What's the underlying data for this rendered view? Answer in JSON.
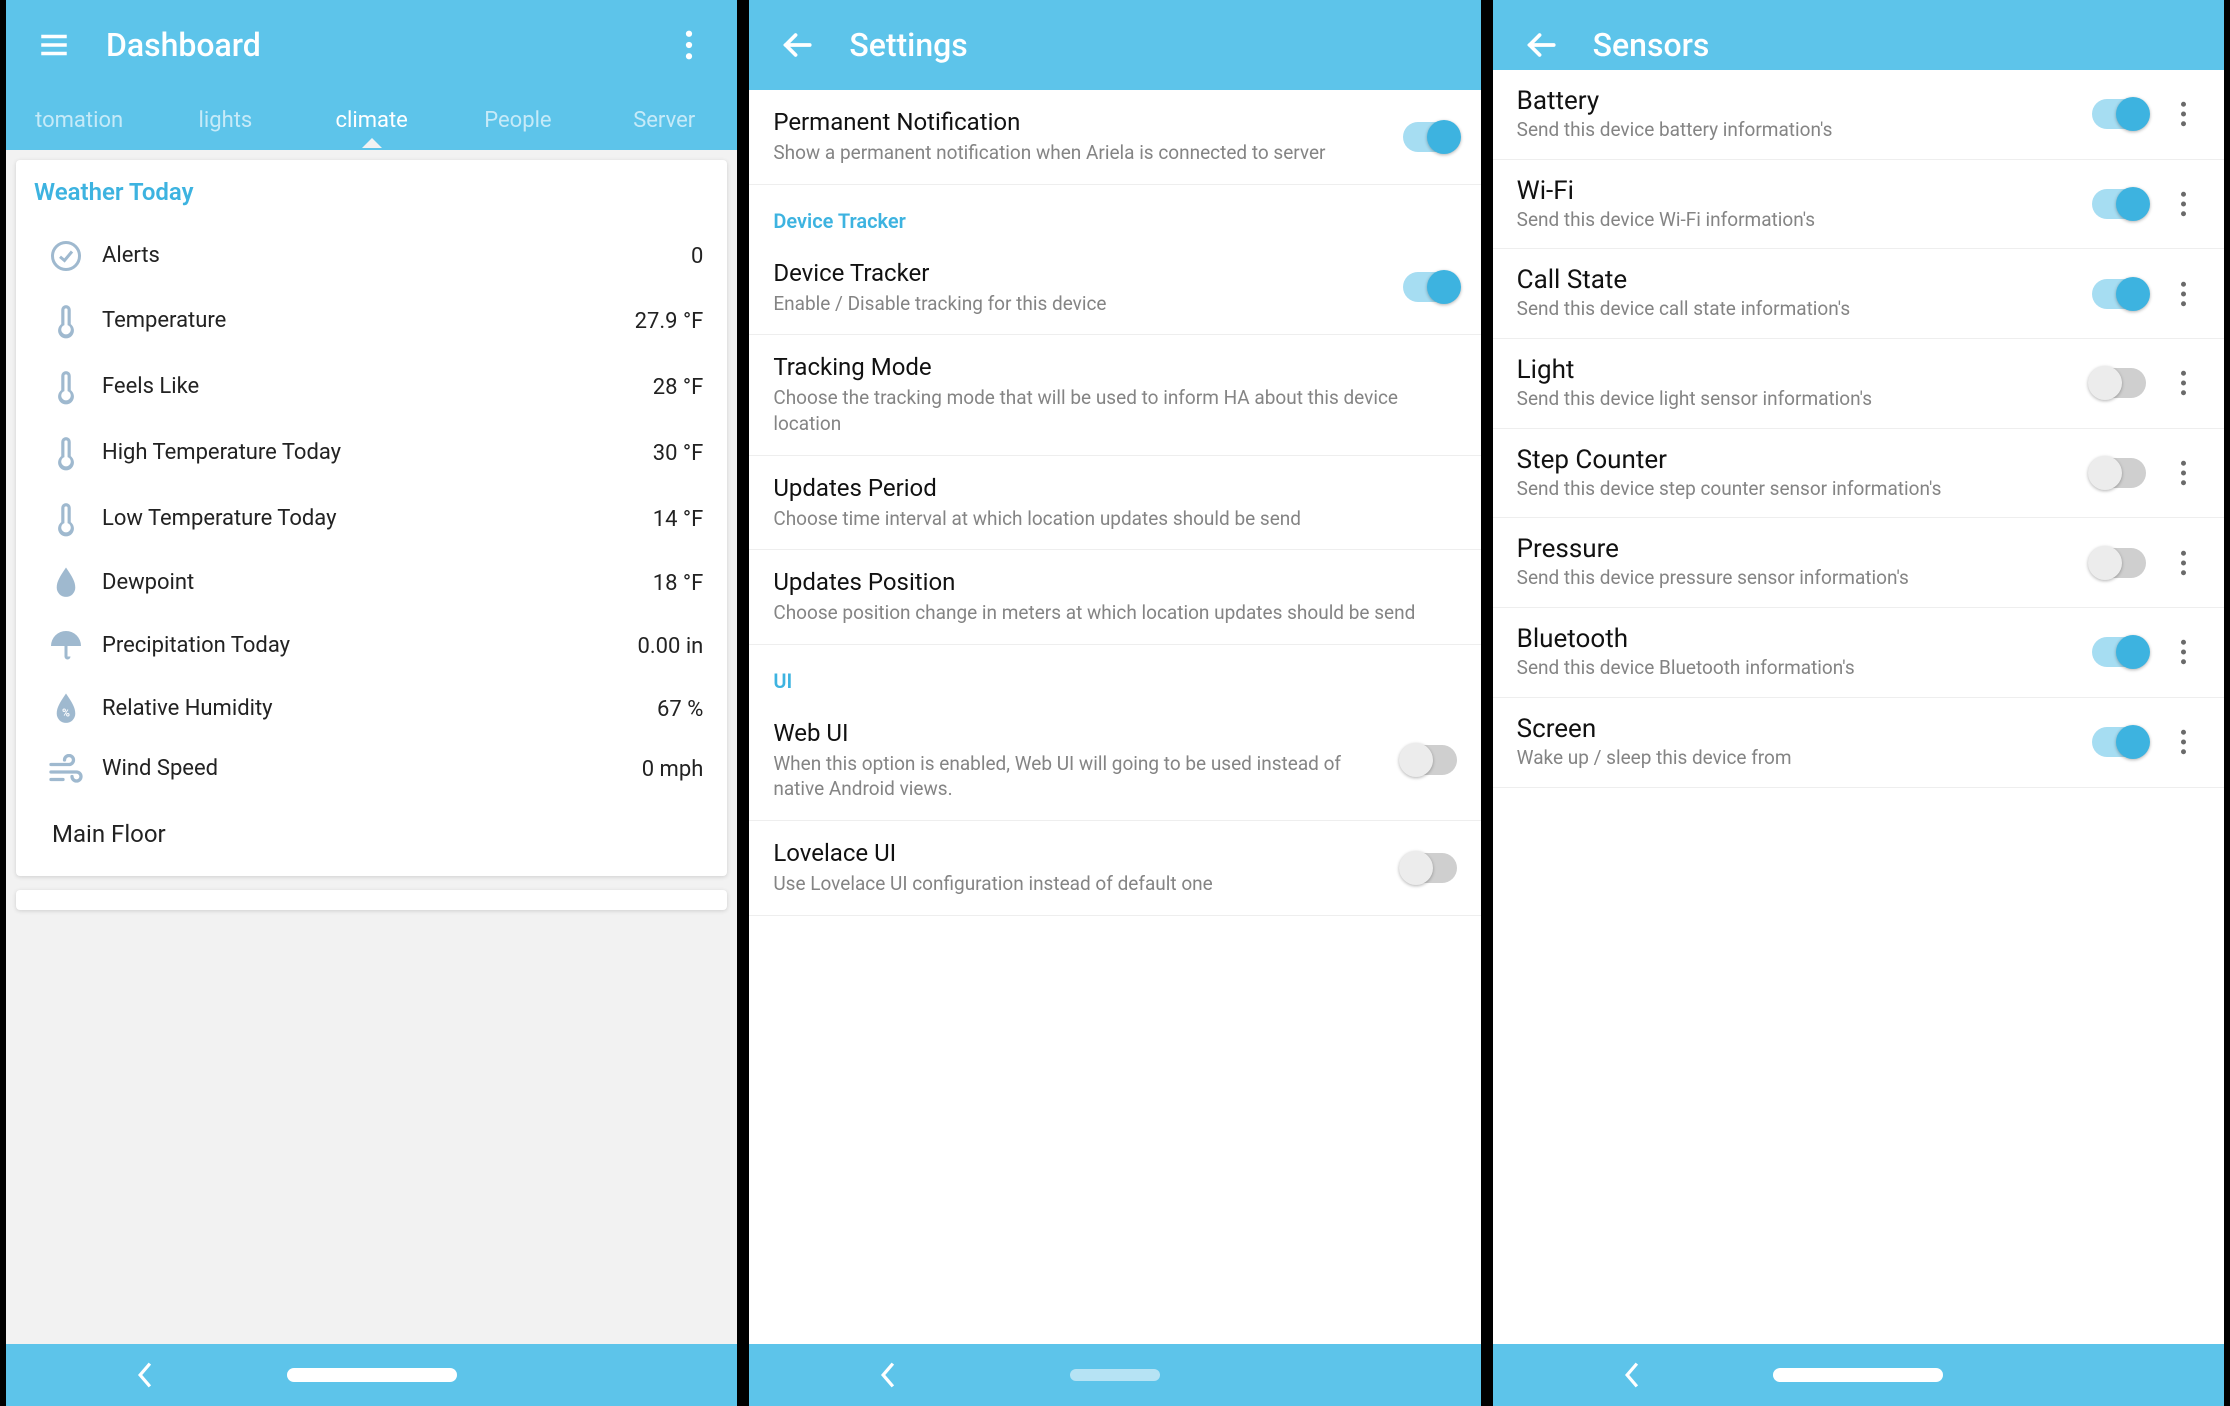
{
  "accent": "#5dc4ea",
  "dashboard": {
    "title": "Dashboard",
    "tabs": [
      "tomation",
      "lights",
      "climate",
      "People",
      "Server"
    ],
    "active_tab": "climate",
    "card_title": "Weather Today",
    "rows": [
      {
        "label": "Alerts",
        "value": "0"
      },
      {
        "label": "Temperature",
        "value": "27.9 °F"
      },
      {
        "label": "Feels Like",
        "value": "28 °F"
      },
      {
        "label": "High Temperature Today",
        "value": "30 °F"
      },
      {
        "label": "Low Temperature Today",
        "value": "14 °F"
      },
      {
        "label": "Dewpoint",
        "value": "18 °F"
      },
      {
        "label": "Precipitation Today",
        "value": "0.00 in"
      },
      {
        "label": "Relative Humidity",
        "value": "67 %"
      },
      {
        "label": "Wind Speed",
        "value": "0 mph"
      }
    ],
    "footer": "Main Floor"
  },
  "settings": {
    "title": "Settings",
    "items": [
      {
        "title": "Permanent Notification",
        "desc": "Show a permanent notification when Ariela is connected to server",
        "toggle": "on"
      },
      {
        "section": "Device Tracker"
      },
      {
        "title": "Device Tracker",
        "desc": "Enable / Disable tracking for this device",
        "toggle": "on"
      },
      {
        "title": "Tracking Mode",
        "desc": "Choose the tracking mode that will be used to inform HA about this device location"
      },
      {
        "title": "Updates Period",
        "desc": "Choose time interval at which location updates should be send"
      },
      {
        "title": "Updates Position",
        "desc": "Choose position change in meters at which location updates should be send"
      },
      {
        "section": "UI"
      },
      {
        "title": "Web UI",
        "desc": "When this option is enabled, Web UI will going to be used instead of native Android views.",
        "toggle": "off"
      },
      {
        "title": "Lovelace UI",
        "desc": "Use Lovelace UI configuration instead of default one",
        "toggle": "off"
      }
    ]
  },
  "sensors": {
    "title": "Sensors",
    "items": [
      {
        "title": "Battery",
        "desc": "Send this device battery information's",
        "toggle": "on"
      },
      {
        "title": "Wi-Fi",
        "desc": "Send this device Wi-Fi information's",
        "toggle": "on"
      },
      {
        "title": "Call State",
        "desc": "Send this device call state information's",
        "toggle": "on"
      },
      {
        "title": "Light",
        "desc": "Send this device light sensor information's",
        "toggle": "off"
      },
      {
        "title": "Step Counter",
        "desc": "Send this device step counter sensor information's",
        "toggle": "off"
      },
      {
        "title": "Pressure",
        "desc": "Send this device pressure sensor information's",
        "toggle": "off"
      },
      {
        "title": "Bluetooth",
        "desc": "Send this device Bluetooth information's",
        "toggle": "on"
      },
      {
        "title": "Screen",
        "desc": "Wake up / sleep this device from",
        "toggle": "on"
      }
    ]
  }
}
